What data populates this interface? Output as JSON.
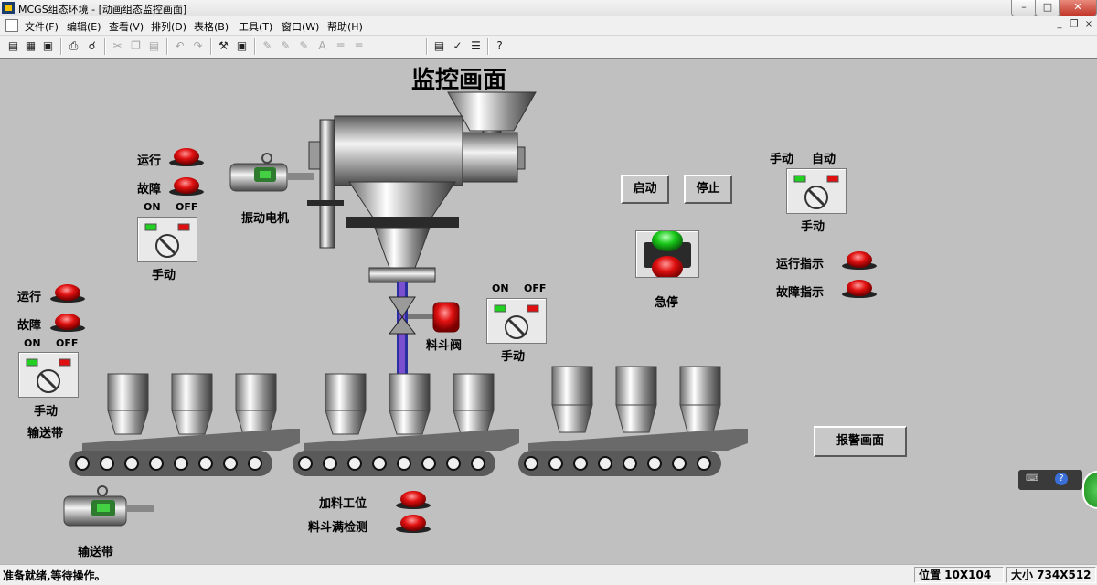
{
  "window": {
    "title": "MCGS组态环境 - [动画组态监控画面]"
  },
  "menu": {
    "items": [
      "文件(F)",
      "编辑(E)",
      "查看(V)",
      "排列(D)",
      "表格(B)",
      "工具(T)",
      "窗口(W)",
      "帮助(H)"
    ]
  },
  "screen": {
    "title": "监控画面",
    "vibration_motor": {
      "label": "振动电机",
      "run_label": "运行",
      "fault_label": "故障",
      "switch_on": "ON",
      "switch_off": "OFF",
      "switch_label": "手动"
    },
    "conveyor": {
      "run_label": "运行",
      "fault_label": "故障",
      "switch_on": "ON",
      "switch_off": "OFF",
      "switch_label": "手动",
      "label": "输送带",
      "motor_label": "输送带"
    },
    "hopper_valve": {
      "label": "料斗阀",
      "switch_on": "ON",
      "switch_off": "OFF",
      "switch_label": "手动"
    },
    "controls": {
      "start_button": "启动",
      "stop_button": "停止",
      "estop_label": "急停"
    },
    "mode_switch": {
      "manual_label": "手动",
      "auto_label": "自动",
      "switch_label": "手动"
    },
    "indicators": {
      "run_indicator": "运行指示",
      "fault_indicator": "故障指示"
    },
    "station": {
      "feeding_position": "加料工位",
      "hopper_full": "料斗满检测"
    },
    "alarm_button": "报警画面"
  },
  "status": {
    "message": "准备就绪,等待操作。",
    "position": "位置 10X104",
    "size": "大小 734X512"
  },
  "colors": {
    "canvas": "#c0c0c0",
    "lamp_red": "#e01010",
    "lamp_green": "#1ccb1c"
  }
}
